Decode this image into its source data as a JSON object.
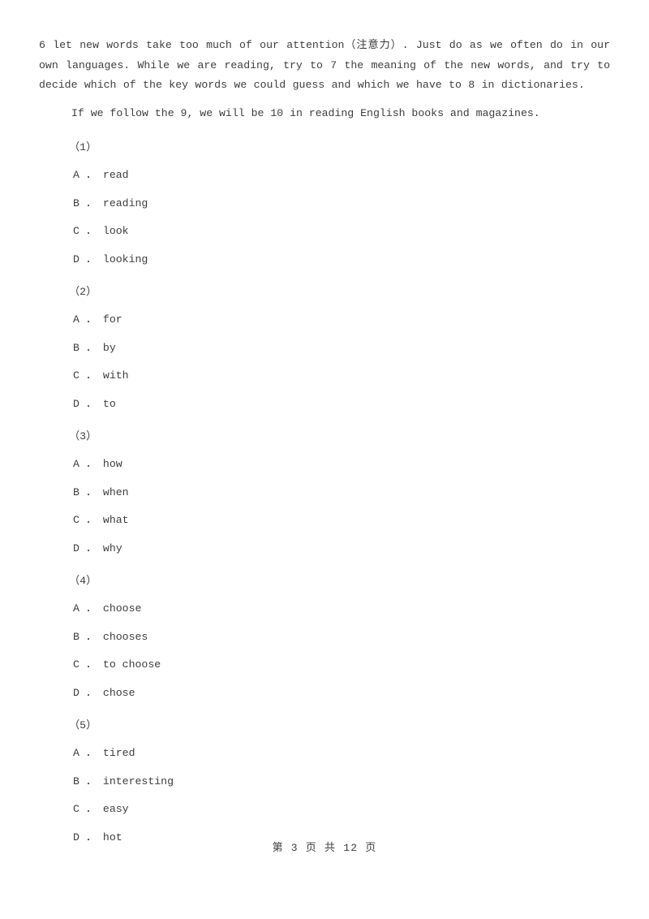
{
  "document": {
    "body_paragraphs": [
      {
        "id": "cloze-passage-continuation",
        "text": "6 let new words take too much of our attention（注意力）. Just do as we often do in our own languages. While we are reading, try to 7 the meaning of the new words, and try to decide which of the key words we could guess and which we have to 8 in dictionaries."
      },
      {
        "id": "cloze-passage-conclusion",
        "text": "If we follow the 9, we will be 10 in reading English books and magazines."
      }
    ],
    "questions": [
      {
        "number": "（1）",
        "options": [
          "A ． read",
          "B ． reading",
          "C ． look",
          "D ． looking"
        ]
      },
      {
        "number": "（2）",
        "options": [
          "A ． for",
          "B ． by",
          "C ． with",
          "D ． to"
        ]
      },
      {
        "number": "（3）",
        "options": [
          "A ． how",
          "B ． when",
          "C ． what",
          "D ． why"
        ]
      },
      {
        "number": "（4）",
        "options": [
          "A ． choose",
          "B ． chooses",
          "C ． to choose",
          "D ． chose"
        ]
      },
      {
        "number": "（5）",
        "options": [
          "A ． tired",
          "B ． interesting",
          "C ． easy",
          "D ． hot"
        ]
      }
    ],
    "footer": {
      "page_label": "第 3 页 共 12 页"
    }
  },
  "colors": {
    "page_background": "#ffffff",
    "text": "#3d3d3d"
  }
}
